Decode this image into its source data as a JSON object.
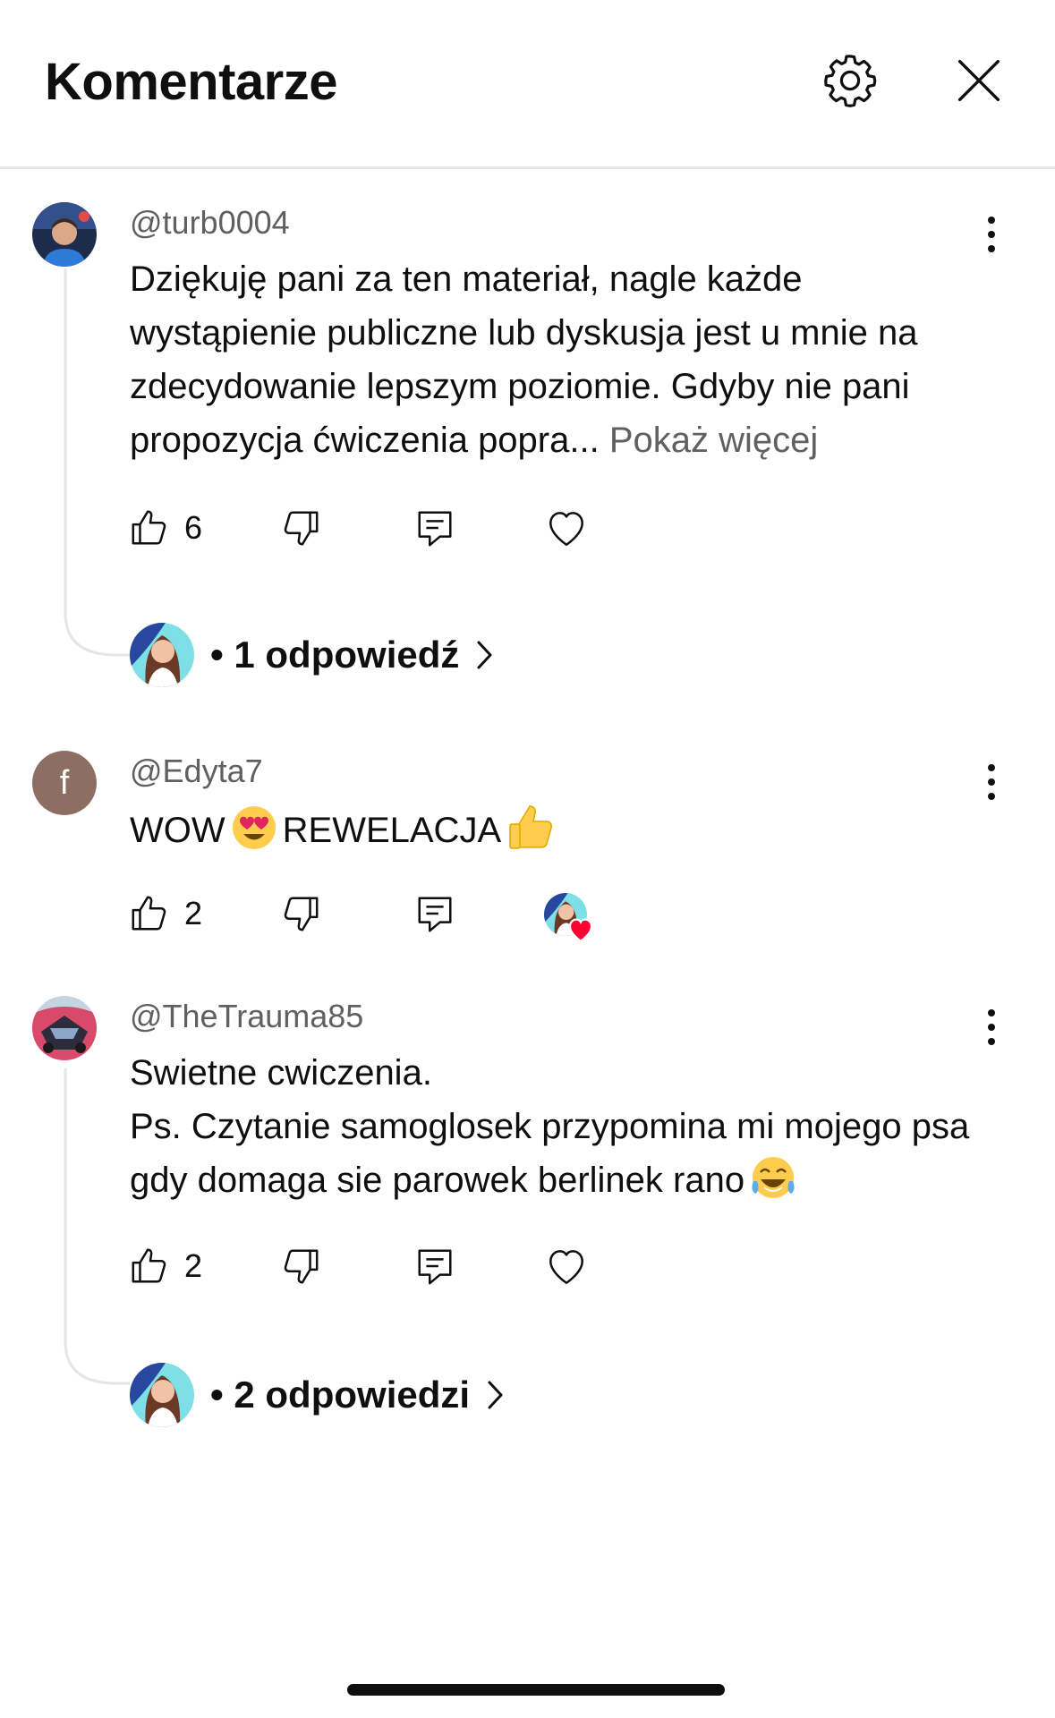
{
  "header": {
    "title": "Komentarze",
    "settings_icon": "gear-icon",
    "close_icon": "close-icon"
  },
  "comments": [
    {
      "username": "@turb0004",
      "text": "Dziękuję pani za ten materiał, nagle każde wystąpienie publiczne lub dyskusja jest u mnie na zdecydowanie lepszym poziomie. Gdyby nie pani propozycja ćwiczenia popra...",
      "show_more": "Pokaż więcej",
      "likes": "6",
      "hearted": false,
      "replies_label": "• 1 odpowiedź"
    },
    {
      "username": "@Edyta7",
      "avatar_letter": "f",
      "text_part1": "WOW",
      "text_part2": "REWELACJA",
      "likes": "2",
      "hearted": true
    },
    {
      "username": "@TheTrauma85",
      "text": "Swietne cwiczenia.\nPs. Czytanie samoglosek przypomina mi mojego psa gdy domaga sie parowek berlinek rano",
      "likes": "2",
      "hearted": false,
      "replies_label": "• 2 odpowiedzi"
    }
  ],
  "colors": {
    "text": "#0f0f0f",
    "secondary": "#606060",
    "divider": "#e5e5e5",
    "heart_badge": "#ff0033"
  }
}
